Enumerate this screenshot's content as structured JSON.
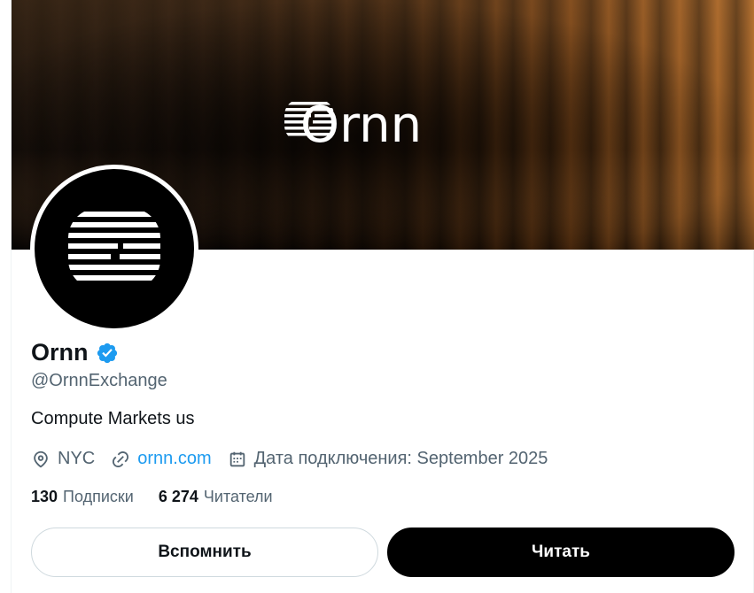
{
  "banner": {
    "wordmark": "Ornn"
  },
  "profile": {
    "display_name": "Ornn",
    "handle": "@OrnnExchange",
    "bio": "Compute Markets us",
    "location": "NYC",
    "website": "ornn.com",
    "joined": "Дата подключения: September 2025"
  },
  "stats": {
    "following_count": "130",
    "following_label": "Подписки",
    "followers_count": "6 274",
    "followers_label": "Читатели"
  },
  "actions": {
    "remember_label": "Вспомнить",
    "follow_label": "Читать"
  },
  "colors": {
    "accent": "#1d9bf0",
    "text_primary": "#0f1419",
    "text_secondary": "#536471"
  },
  "icons": [
    "location-pin-icon",
    "link-icon",
    "calendar-icon",
    "verified-badge-icon",
    "ornn-logo-icon"
  ]
}
